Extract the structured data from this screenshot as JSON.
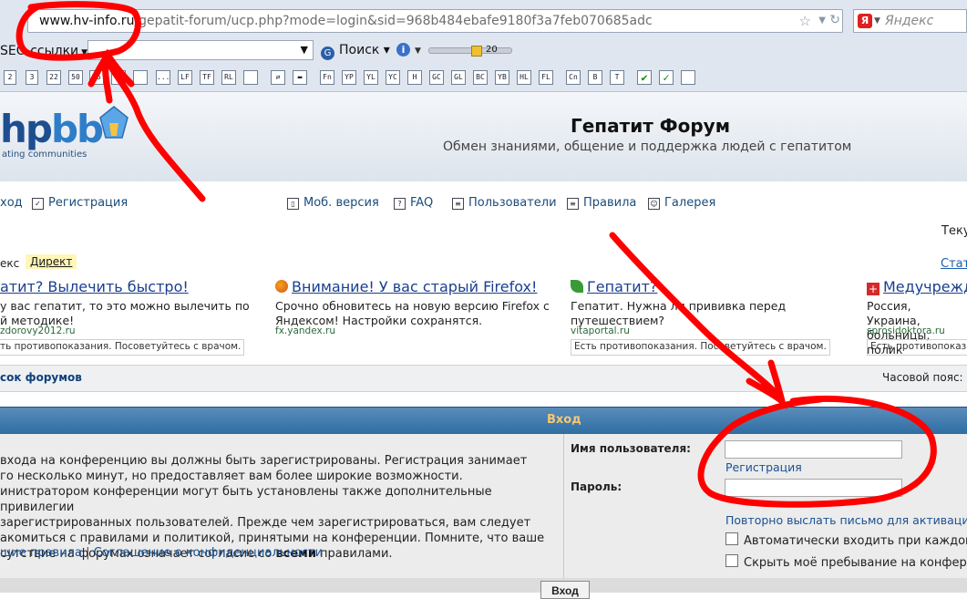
{
  "browser": {
    "url_host": "www.hv-info.ru",
    "url_rest": "/gepatit-forum/ucp.php?mode=login&sid=968b484ebafe9180f3a7feb070685adc",
    "search_engine": "Яндекс",
    "seo_label": "SEO ссылки",
    "search_label": "Поиск",
    "zoom_value": "20",
    "toolbar_buttons": [
      "2",
      "3",
      "22",
      "50",
      "75",
      "",
      "",
      "...",
      "LF",
      "TF",
      "RL",
      "",
      "",
      "",
      "Fn",
      "YP",
      "YL",
      "YC",
      "H",
      "GC",
      "GL",
      "BC",
      "YB",
      "HL",
      "FL",
      "Cn",
      "B",
      "T"
    ],
    "icons": {
      "star": "bookmark-star-icon",
      "reload": "reload-icon",
      "info": "info-icon"
    }
  },
  "site": {
    "logo_text_a": "hp",
    "logo_text_b": "bb",
    "logo_sub": "ating communities",
    "title": "Гепатит Форум",
    "description": "Обмен знаниями, общение и поддержка людей с гепатитом"
  },
  "nav": {
    "login_fragment": "ход",
    "register": "Регистрация",
    "mobile": "Моб. версия",
    "faq": "FAQ",
    "users": "Пользователи",
    "rules": "Правила",
    "gallery": "Галерея",
    "current_time_fragment": "Теку"
  },
  "ads": {
    "direct_prefix": "екс",
    "direct_label": "Директ",
    "stat_fragment": "Стат",
    "items": [
      {
        "title": "атит? Вылечить быстро!",
        "text": "у вас гепатит, то это можно вылечить по\nй методике!",
        "host": "zdorovy2012.ru",
        "warn": "ть противопоказания. Посоветуйтесь с врачом."
      },
      {
        "title": "Внимание! У вас старый Firefox!",
        "text": "Срочно обновитесь на новую версию Firefox с\nЯндексом! Настройки сохранятся.",
        "host": "fx.yandex.ru",
        "warn": ""
      },
      {
        "title": "Гепатит?",
        "text": "Гепатит. Нужна ли прививка перед\nпутешествием?",
        "host": "vitaportal.ru",
        "warn": "Есть противопоказания. Посоветуйтесь с врачом."
      },
      {
        "title": "Медучрежд",
        "text": "Россия, Украина,\nбольницы, полик",
        "host": "sprosidoktora.ru",
        "warn": "Есть противопоказ"
      }
    ]
  },
  "breadcrumb": {
    "forum_list": "сок форумов",
    "timezone": "Часовой пояс:"
  },
  "login": {
    "header": "Вход",
    "info_lines": "  входа на конференцию вы должны быть зарегистрированы. Регистрация занимает\nго несколько минут, но предоставляет вам более широкие возможности.\nинистратором конференции могут быть установлены также дополнительные привилегии\n зарегистрированных пользователей. Прежде чем зарегистрироваться, вам следует\nакомиться с правилами и политикой, принятыми на конференции. Помните, что ваше\nсутствие на форумах означает согласие со ",
    "info_bold": "всеми",
    "info_tail": " правилами.",
    "rules_link": "щие правила",
    "privacy_link": "Соглашение о конфиденциальности",
    "username_label": "Имя пользователя:",
    "password_label": "Пароль:",
    "username_value": "",
    "password_value": "",
    "register_link": "Регистрация",
    "resend_link": "Повторно выслать письмо для активации",
    "autologin_label": "Автоматически входить при каждом п",
    "hide_label": "Скрыть моё пребывание на конферен",
    "submit_label": "Вход"
  },
  "annotation_color": "#ff0000"
}
